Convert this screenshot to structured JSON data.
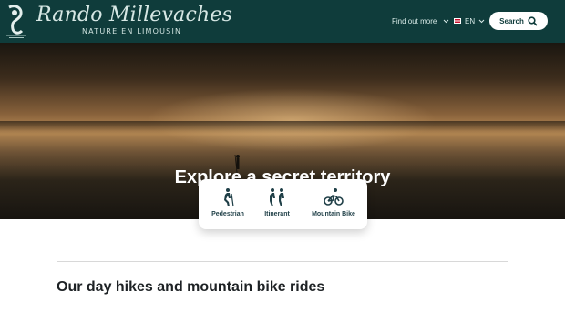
{
  "header": {
    "logo_script": "Rando Millevaches",
    "logo_tagline": "NATURE EN LIMOUSIN",
    "nav_find_label": "Find out more",
    "lang_label": "EN",
    "search_label": "Search"
  },
  "hero": {
    "title": "Explore a secret territory"
  },
  "activities": [
    {
      "label": "Pedestrian",
      "icon": "hiker-icon"
    },
    {
      "label": "Itinerant",
      "icon": "two-hikers-icon"
    },
    {
      "label": "Mountain Bike",
      "icon": "cyclist-icon"
    }
  ],
  "main": {
    "section_title": "Our day hikes and mountain bike rides"
  },
  "colors": {
    "header_bg": "#0f3c3b",
    "activity_text": "#1f3f47"
  }
}
